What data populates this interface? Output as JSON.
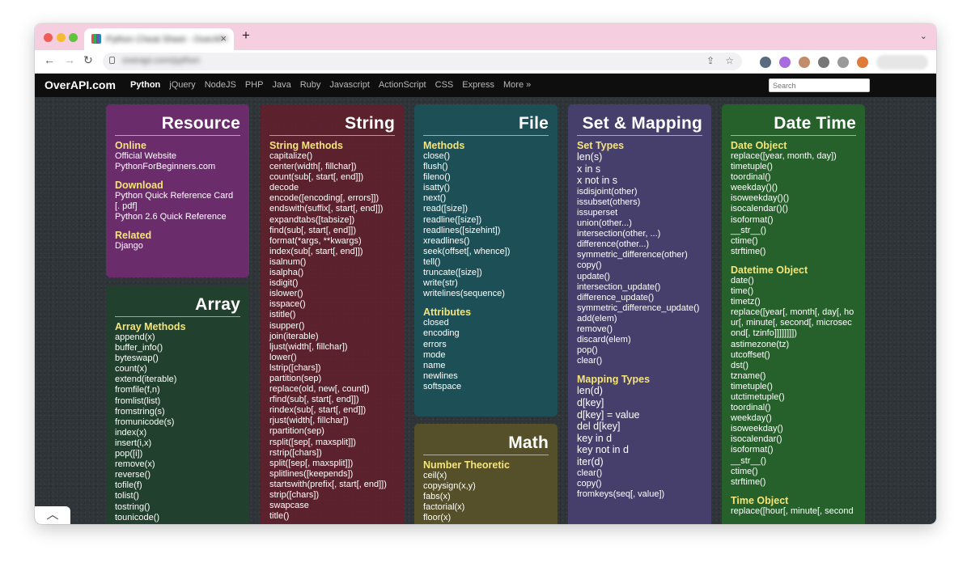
{
  "browser": {
    "tab_title": "Python Cheat Sheet - OverAPI",
    "url": "overapi.com/python",
    "new_tab_label": "+"
  },
  "site": {
    "logo": "OverAPI.com",
    "nav": [
      "Python",
      "jQuery",
      "NodeJS",
      "PHP",
      "Java",
      "Ruby",
      "Javascript",
      "ActionScript",
      "CSS",
      "Express",
      "More »"
    ],
    "search_placeholder": "Search"
  },
  "cards": {
    "resource": {
      "title": "Resource",
      "sections": [
        {
          "heading": "Online",
          "items": [
            "Official Website",
            "PythonForBeginners.com"
          ]
        },
        {
          "heading": "Download",
          "items": [
            "Python Quick Reference Card [. pdf]",
            "Python 2.6 Quick Reference"
          ]
        },
        {
          "heading": "Related",
          "items": [
            "Django"
          ]
        }
      ]
    },
    "array": {
      "title": "Array",
      "sections": [
        {
          "heading": "Array Methods",
          "items": [
            "append(x)",
            "buffer_info()",
            "byteswap()",
            "count(x)",
            "extend(iterable)",
            "fromfile(f,n)",
            "fromlist(list)",
            "fromstring(s)",
            "fromunicode(s)",
            "index(x)",
            "insert(i,x)",
            "pop([i])",
            "remove(x)",
            "reverse()",
            "tofile(f)",
            "tolist()",
            "tostring()",
            "tounicode()"
          ]
        }
      ]
    },
    "string": {
      "title": "String",
      "sections": [
        {
          "heading": "String Methods",
          "items": [
            "capitalize()",
            "center(width[, fillchar])",
            "count(sub[, start[, end]])",
            "decode",
            "encode([encoding[, errors]])",
            "endswith(suffix[, start[, end]])",
            "expandtabs([tabsize])",
            "find(sub[, start[, end]])",
            "format(*args, **kwargs)",
            "index(sub[, start[, end]])",
            "isalnum()",
            "isalpha()",
            "isdigit()",
            "islower()",
            "isspace()",
            "istitle()",
            "isupper()",
            "join(iterable)",
            "ljust(width[, fillchar])",
            "lower()",
            "lstrip([chars])",
            "partition(sep)",
            "replace(old, new[, count])",
            "rfind(sub[, start[, end]])",
            "rindex(sub[, start[, end]])",
            "rjust(width[, fillchar])",
            "rpartition(sep)",
            "rsplit([sep[, maxsplit]])",
            "rstrip([chars])",
            "split([sep[, maxsplit]])",
            "splitlines([keepends])",
            "startswith(prefix[, start[, end]])",
            "strip([chars])",
            "swapcase",
            "title()"
          ]
        }
      ]
    },
    "file": {
      "title": "File",
      "sections": [
        {
          "heading": "Methods",
          "items": [
            "close()",
            "flush()",
            "fileno()",
            "isatty()",
            "next()",
            "read([size])",
            "readline([size])",
            "readlines([sizehint])",
            "xreadlines()",
            "seek(offset[, whence])",
            "tell()",
            "truncate([size])",
            "write(str)",
            "writelines(sequence)"
          ]
        },
        {
          "heading": "Attributes",
          "items": [
            "closed",
            "encoding",
            "errors",
            "mode",
            "name",
            "newlines",
            "softspace"
          ]
        }
      ]
    },
    "math": {
      "title": "Math",
      "sections": [
        {
          "heading": "Number Theoretic",
          "items": [
            "ceil(x)",
            "copysign(x,y)",
            "fabs(x)",
            "factorial(x)",
            "floor(x)"
          ]
        }
      ]
    },
    "set_mapping": {
      "title": "Set & Mapping",
      "sections": [
        {
          "heading": "Set Types",
          "big_items": [
            "len(s)",
            "x in s",
            "x not in s"
          ],
          "items": [
            "isdisjoint(other)",
            "issubset(others)",
            "issuperset",
            "union(other...)",
            "intersection(other, ...)",
            "difference(other...)",
            "symmetric_difference(other)",
            "copy()",
            "update()",
            "intersection_update()",
            "difference_update()",
            "symmetric_difference_update()",
            "add(elem)",
            "remove()",
            "discard(elem)",
            "pop()",
            "clear()"
          ]
        },
        {
          "heading": "Mapping Types",
          "big_items": [
            "len(d)",
            "d[key]",
            "d[key] = value",
            "del d[key]",
            "key in d",
            "key not in d",
            "iter(d)"
          ],
          "items": [
            "clear()",
            "copy()",
            "fromkeys(seq[, value])"
          ]
        }
      ]
    },
    "datetime": {
      "title": "Date Time",
      "sections": [
        {
          "heading": "Date Object",
          "items": [
            "replace([year, month, day])",
            "timetuple()",
            "toordinal()",
            "weekday()()",
            "isoweekday()()",
            "isocalendar()()",
            "isoformat()",
            "__str__()",
            "ctime()",
            "strftime()"
          ]
        },
        {
          "heading": "Datetime Object",
          "items": [
            "date()",
            "time()",
            "timetz()",
            "replace([year[, month[, day[, ho ur[, minute[, second[, microsec ond[, tzinfo]]]]]]]])",
            "astimezone(tz)",
            "utcoffset()",
            "dst()",
            "tzname()",
            "timetuple()",
            "utctimetuple()",
            "toordinal()",
            "weekday()",
            "isoweekday()",
            "isocalendar()",
            "isoformat()",
            "__str__()",
            "ctime()",
            "strftime()"
          ]
        },
        {
          "heading": "Time Object",
          "items": [
            "replace([hour[, minute[, second"
          ]
        }
      ]
    }
  },
  "scroll_top_icon": "chevron-up-icon"
}
